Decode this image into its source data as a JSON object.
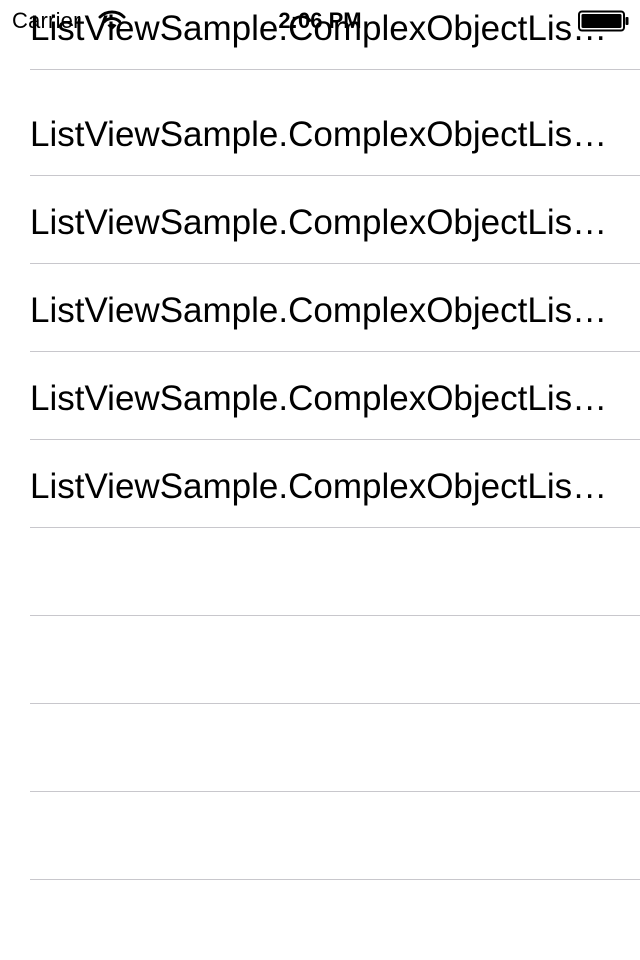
{
  "status_bar": {
    "carrier": "Carrier",
    "time": "2:06 PM",
    "icons": [
      "wifi-icon",
      "battery-icon"
    ]
  },
  "list": {
    "items": [
      {
        "label": "ListViewSample.ComplexObjectListViewPage+ComplexObject"
      },
      {
        "label": "ListViewSample.ComplexObjectListViewPage+ComplexObject"
      },
      {
        "label": "ListViewSample.ComplexObjectListViewPage+ComplexObject"
      },
      {
        "label": "ListViewSample.ComplexObjectListViewPage+ComplexObject"
      },
      {
        "label": "ListViewSample.ComplexObjectListViewPage+ComplexObject"
      },
      {
        "label": "ListViewSample.ComplexObjectListViewPage+ComplexObject"
      },
      {
        "label": ""
      },
      {
        "label": ""
      },
      {
        "label": ""
      },
      {
        "label": ""
      }
    ]
  },
  "colors": {
    "separator": "#c8c7cc",
    "background": "#ffffff",
    "text": "#000000"
  }
}
